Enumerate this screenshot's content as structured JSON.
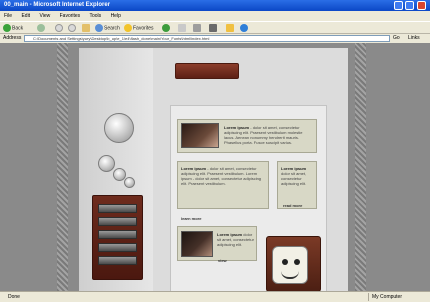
{
  "window": {
    "title": "00_main - Microsoft Internet Explorer"
  },
  "menu": [
    "File",
    "Edit",
    "View",
    "Favorites",
    "Tools",
    "Help"
  ],
  "toolbar": {
    "back": "Back",
    "search": "Search",
    "favorites": "Favorites"
  },
  "address": {
    "label": "Address",
    "url": "C:\\Documents and Settings\\yury\\Desktop\\b_up\\e_1\\e4\\flash_done\\main\\Your_Fonts\\html\\index.html",
    "go": "Go",
    "links": "Links"
  },
  "content": {
    "top_card": {
      "lead": "Lorem ipsum",
      "text": "- dolor sit amet, consectetur adipiscing elit. Praesent vestibulum molestie lacus. Aenean nonummy hendrerit mauris. Phasellus porta. Fusce suscipit varius."
    },
    "mid_card": {
      "lead": "Lorem ipsum",
      "text": "- dolor sit amet, consectetur adipiscing elit. Praesent vestibulum. Lorem ipsum - dolor sit amet, consectetur adipiscing elit. Praesent vestibulum.",
      "more": "learn more"
    },
    "right_card": {
      "lead": "Lorem ipsum",
      "text": "dolor sit amet, consectetur adipiscing elit.",
      "more": "read more"
    },
    "bottom_card": {
      "lead": "Lorem ipsum",
      "text": "dolor sit amet, consectetur adipiscing elit.",
      "more": "view"
    }
  },
  "status": {
    "left": "Done",
    "right": "My Computer"
  }
}
